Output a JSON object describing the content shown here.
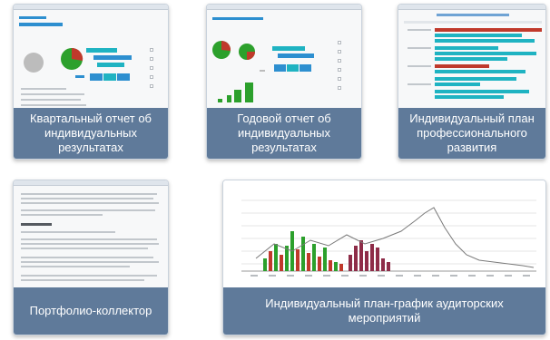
{
  "colors": {
    "caption_bg": "#5f7a9a",
    "teal": "#1fb3c2",
    "blue": "#2d8fd0",
    "green": "#2ca02c",
    "red": "#c0392b",
    "maroon": "#8e2c48",
    "gray": "#bcbcbc"
  },
  "cards": [
    {
      "caption": "Квартальный отчет об индивидуальных результатах",
      "thumbnail": "quarterly-report-screenshot"
    },
    {
      "caption": "Годовой отчет об индивидуальных результатах",
      "thumbnail": "annual-report-screenshot"
    },
    {
      "caption": "Индивидуальный план профессионального развития",
      "thumbnail": "development-plan-screenshot"
    },
    {
      "caption": "Портфолио-коллектор",
      "thumbnail": "portfolio-screenshot"
    },
    {
      "caption": "Индивидуальный план-график аудиторских мероприятий",
      "thumbnail": "audit-schedule-chart"
    }
  ]
}
